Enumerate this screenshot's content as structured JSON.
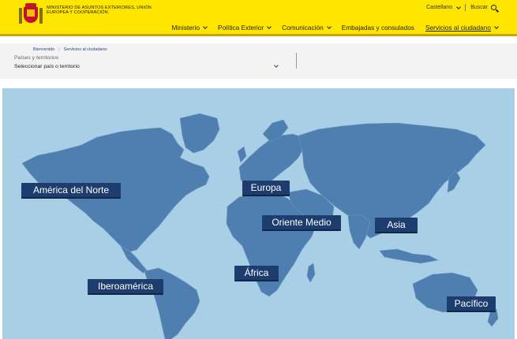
{
  "header": {
    "ministry_name": "MINISTERIO DE ASUNTOS EXTERIORES, UNIÓN EUROPEA Y COOPERACIÓN",
    "language": "Castellano",
    "search_label": "Buscar",
    "nav": [
      {
        "label": "Ministerio",
        "has_dropdown": true
      },
      {
        "label": "Política Exterior",
        "has_dropdown": true
      },
      {
        "label": "Comunicación",
        "has_dropdown": true
      },
      {
        "label": "Embajadas y consulados",
        "has_dropdown": false
      },
      {
        "label": "Servicios al ciudadano",
        "has_dropdown": true,
        "active": true
      }
    ],
    "bg_color": "#ffe600"
  },
  "breadcrumb": [
    "Bienvenido",
    "Servicios al ciudadano"
  ],
  "filter": {
    "label": "Países y territorios",
    "placeholder": "Seleccionar país o territorio"
  },
  "map": {
    "ocean_color": "#a9cfe7",
    "land_color": "#4f7eb0",
    "button_color": "#1c3d6e",
    "regions": [
      "América del Norte",
      "Europa",
      "Oriente Medio",
      "Asia",
      "África",
      "Iberoamérica",
      "Pacífico"
    ]
  }
}
